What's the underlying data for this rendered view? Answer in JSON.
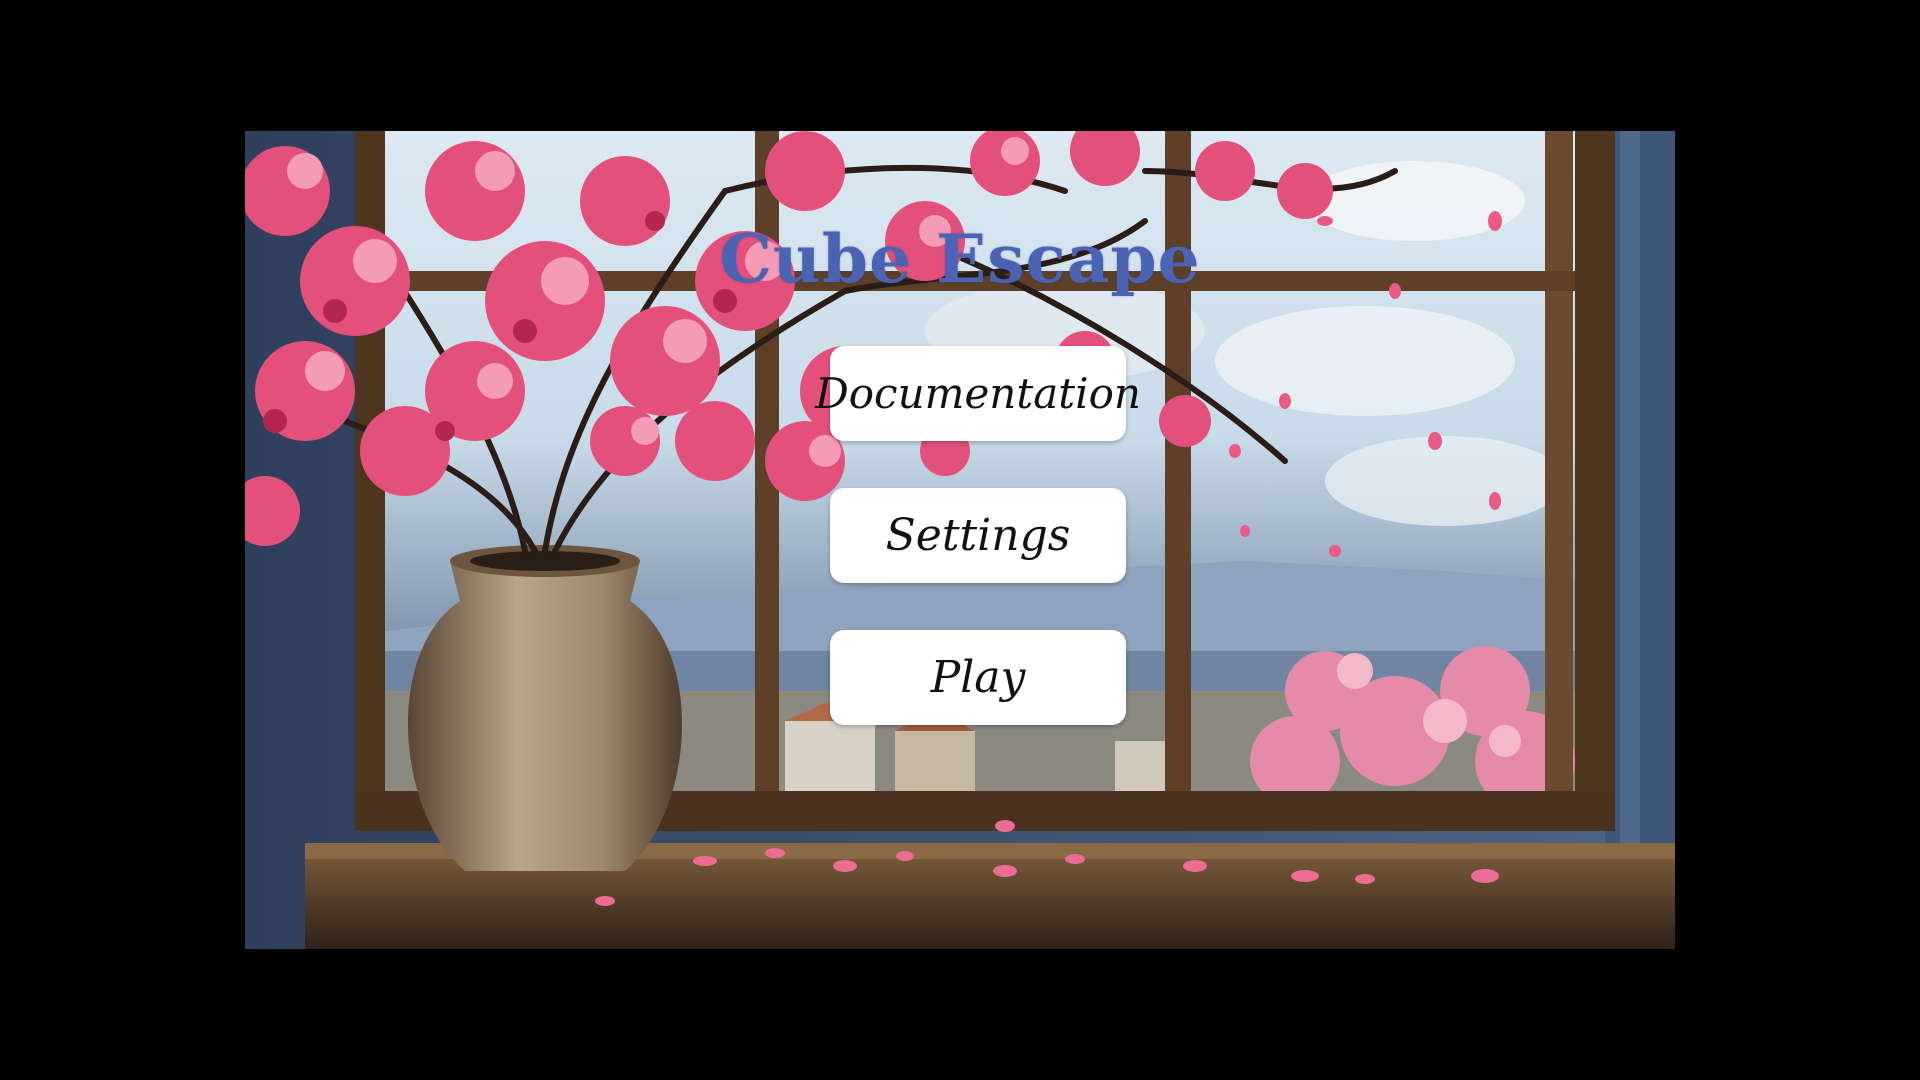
{
  "game": {
    "title": "Cube Escape"
  },
  "menu": {
    "documentation_label": "Documentation",
    "settings_label": "Settings",
    "play_label": "Play"
  },
  "colors": {
    "letterbox": "#000000",
    "title": "#4a63b3",
    "button_bg": "#ffffff",
    "button_text": "#111111",
    "blossom": "#e5527e",
    "frame_wood": "#5a3a22",
    "sky": "#c9dcea",
    "wall": "#3c4f70"
  }
}
